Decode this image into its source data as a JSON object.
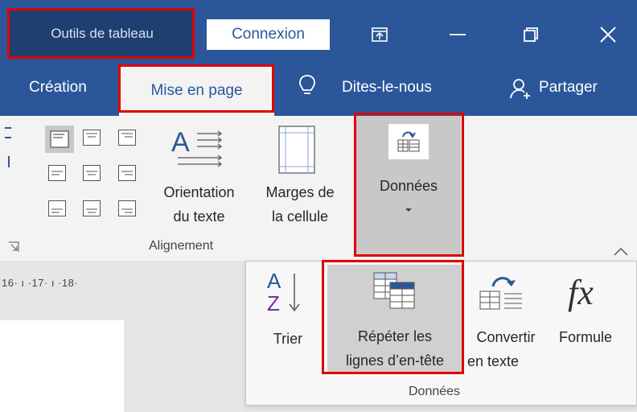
{
  "titlebar": {
    "context_title": "Outils de tableau",
    "signin_label": "Connexion",
    "minimize_icon": "minimize-icon",
    "maximize_icon": "restore-icon",
    "close_icon": "close-icon"
  },
  "tabs": {
    "creation": "Création",
    "mise_en_page": "Mise en page",
    "tell_me": "Dites-le-nous",
    "share": "Partager"
  },
  "ribbon": {
    "text_direction": [
      "Orientation",
      "du texte"
    ],
    "cell_margins": [
      "Marges de",
      "la cellule"
    ],
    "data_button": "Données",
    "alignment_group": "Alignement"
  },
  "ruler": {
    "text": "16· ı ·17· ı ·18·"
  },
  "data_panel": {
    "sort": "Trier",
    "sort_glyph_a": "A",
    "sort_glyph_z": "Z",
    "repeat_header": [
      "Répéter les",
      "lignes d’en-tête"
    ],
    "convert": [
      "Convertir",
      "en texte"
    ],
    "formula": "Formule",
    "formula_glyph": "fx",
    "group_label": "Données"
  },
  "colors": {
    "accent": "#2b579a",
    "highlight": "#e10000"
  }
}
